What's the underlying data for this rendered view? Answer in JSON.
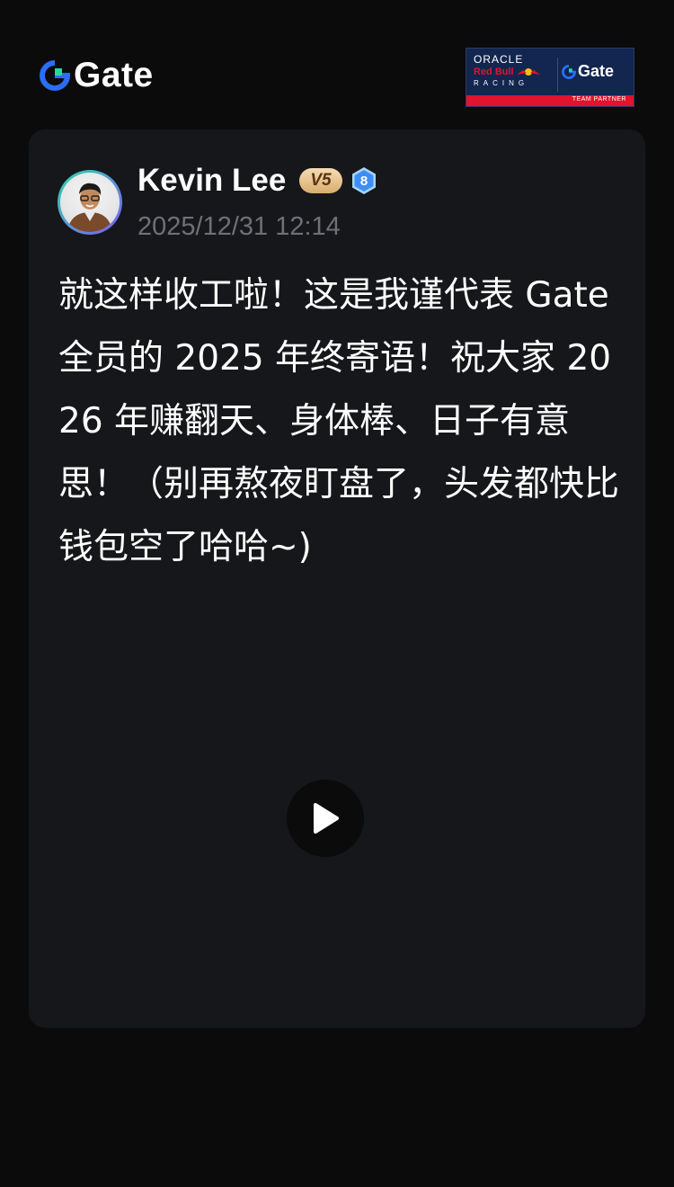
{
  "header": {
    "brand_name": "Gate",
    "brand_color": "#2a6df6",
    "partner": {
      "oracle": "ORACLE",
      "redbull": "Red Bull",
      "racing": "RACING",
      "gate": "Gate",
      "label": "TEAM PARTNER"
    }
  },
  "post": {
    "author": "Kevin Lee",
    "vip_level": "V5",
    "user_level": "8",
    "timestamp": "2025/12/31 12:14",
    "content": "就这样收工啦！这是我谨代表 Gate 全员的 2025 年终寄语！祝大家 2026 年赚翻天、身体棒、日子有意思！（别再熬夜盯盘了，头发都快比钱包空了哈哈~)",
    "media": {
      "type": "video",
      "icon": "play-icon"
    }
  },
  "colors": {
    "background": "#0b0b0c",
    "card": "#16171a",
    "timestamp": "#6e7077",
    "vip_badge": "#e3bb86",
    "level_badge": "#3d8ff5"
  }
}
